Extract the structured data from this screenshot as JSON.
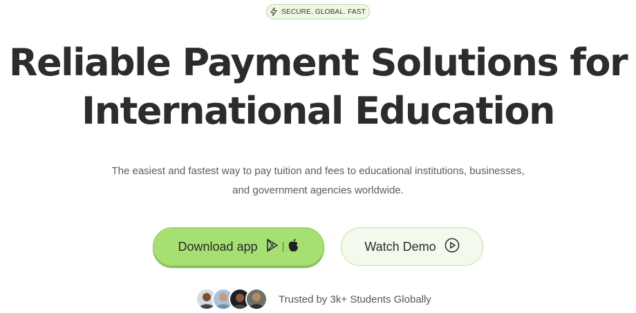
{
  "badge": {
    "icon": "lightning-icon",
    "text": "SECURE. GLOBAL. FAST"
  },
  "hero": {
    "headline_line1": "Reliable Payment Solutions for",
    "headline_line2": "International Education",
    "subtitle_line1": "The easiest and fastest way to pay tuition and fees to educational institutions, businesses,",
    "subtitle_line2": "and government agencies worldwide."
  },
  "buttons": {
    "download_label": "Download app",
    "download_icons": [
      "google-play-icon",
      "apple-icon"
    ],
    "demo_label": "Watch Demo",
    "demo_icon": "play-circle-icon"
  },
  "social_proof": {
    "avatars": [
      "avatar-1",
      "avatar-2",
      "avatar-3",
      "avatar-4"
    ],
    "text": "Trusted by 3k+ Students Globally"
  },
  "colors": {
    "accent_green": "#a6df72",
    "badge_bg": "#edf7e4",
    "text_dark": "#2c2c2c"
  }
}
